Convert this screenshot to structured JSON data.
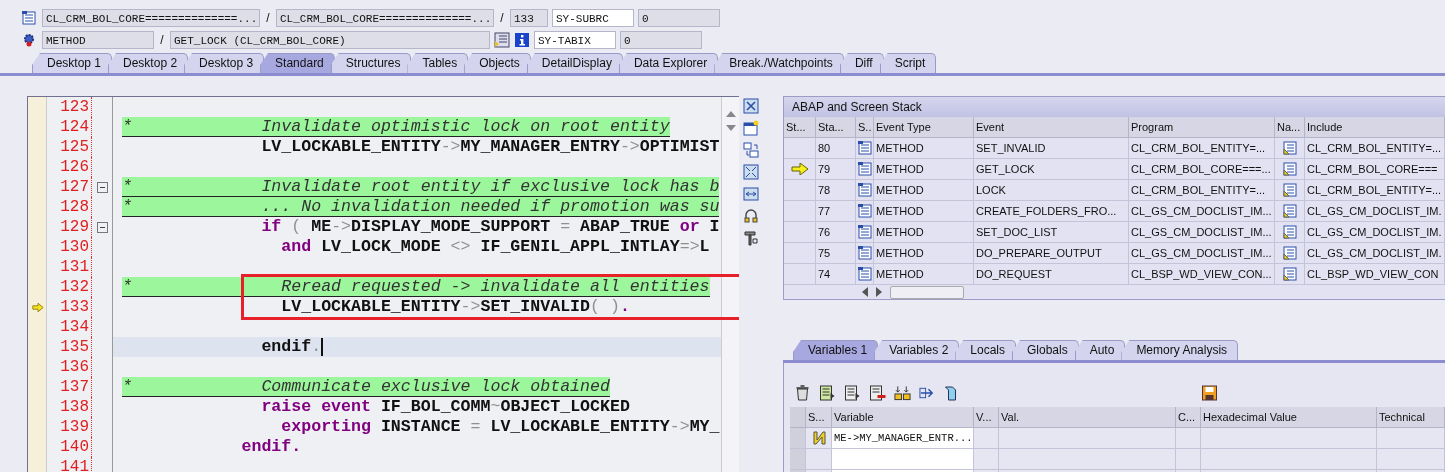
{
  "header": {
    "program": "CL_CRM_BOL_CORE==============...",
    "include": "CL_CRM_BOL_CORE==============...",
    "line": "133",
    "separators": [
      "/",
      "/",
      "/"
    ],
    "event_type": "METHOD",
    "event": "GET_LOCK (CL_CRM_BOL_CORE)",
    "sy_fields": [
      {
        "name": "SY-SUBRC",
        "value": "0"
      },
      {
        "name": "SY-TABIX",
        "value": "0"
      }
    ]
  },
  "tabs": [
    {
      "label": "Desktop 1",
      "selected": false
    },
    {
      "label": "Desktop 2",
      "selected": false
    },
    {
      "label": "Desktop 3",
      "selected": false
    },
    {
      "label": "Standard",
      "selected": true
    },
    {
      "label": "Structures",
      "selected": false
    },
    {
      "label": "Tables",
      "selected": false
    },
    {
      "label": "Objects",
      "selected": false
    },
    {
      "label": "DetailDisplay",
      "selected": false
    },
    {
      "label": "Data Explorer",
      "selected": false
    },
    {
      "label": "Break./Watchpoints",
      "selected": false
    },
    {
      "label": "Diff",
      "selected": false
    },
    {
      "label": "Script",
      "selected": false
    }
  ],
  "code": {
    "lines": [
      {
        "no": "123",
        "kind": "blank",
        "fold": false,
        "current": false,
        "cursor": false,
        "boxed": false
      },
      {
        "no": "124",
        "kind": "comment",
        "text": "*             Invalidate optimistic lock on root entity",
        "fold": false,
        "current": false,
        "cursor": false,
        "boxed": false
      },
      {
        "no": "125",
        "kind": "code",
        "tokens": [
          {
            "kind": "id",
            "text": "              LV_LOCKABLE_ENTITY"
          },
          {
            "kind": "op",
            "text": "->"
          },
          {
            "kind": "id",
            "text": "MY_MANAGER_ENTRY"
          },
          {
            "kind": "op",
            "text": "->"
          },
          {
            "kind": "id",
            "text": "OPTIMIST"
          }
        ],
        "fold": false,
        "current": false,
        "cursor": false,
        "boxed": false
      },
      {
        "no": "126",
        "kind": "blank",
        "fold": false,
        "current": false,
        "cursor": false,
        "boxed": false
      },
      {
        "no": "127",
        "kind": "comment",
        "text": "*             Invalidate root entity if exclusive lock has b",
        "fold": true,
        "current": false,
        "cursor": false,
        "boxed": false
      },
      {
        "no": "128",
        "kind": "comment",
        "text": "*             ... No invalidation needed if promotion was su",
        "fold": false,
        "current": false,
        "cursor": false,
        "boxed": false
      },
      {
        "no": "129",
        "kind": "code",
        "tokens": [
          {
            "kind": "kw",
            "text": "              if"
          },
          {
            "kind": "op",
            "text": " ( "
          },
          {
            "kind": "id",
            "text": "ME"
          },
          {
            "kind": "op",
            "text": "->"
          },
          {
            "kind": "id",
            "text": "DISPLAY_MODE_SUPPORT"
          },
          {
            "kind": "op",
            "text": " = "
          },
          {
            "kind": "id",
            "text": "ABAP_TRUE"
          },
          {
            "kind": "kw",
            "text": " or "
          },
          {
            "kind": "id",
            "text": "I"
          }
        ],
        "fold": true,
        "current": false,
        "cursor": false,
        "boxed": false
      },
      {
        "no": "130",
        "kind": "code",
        "tokens": [
          {
            "kind": "kw",
            "text": "                and"
          },
          {
            "kind": "id",
            "text": " LV_LOCK_MODE"
          },
          {
            "kind": "op",
            "text": " <> "
          },
          {
            "kind": "id",
            "text": "IF_GENIL_APPL_INTLAY"
          },
          {
            "kind": "op",
            "text": "=>"
          },
          {
            "kind": "id",
            "text": "L"
          }
        ],
        "fold": false,
        "current": false,
        "cursor": false,
        "boxed": false
      },
      {
        "no": "131",
        "kind": "blank",
        "fold": false,
        "current": false,
        "cursor": false,
        "boxed": false
      },
      {
        "no": "132",
        "kind": "comment",
        "text": "*               Reread requested -> invalidate all entities",
        "fold": false,
        "current": false,
        "cursor": false,
        "boxed": true
      },
      {
        "no": "133",
        "kind": "code",
        "tokens": [
          {
            "kind": "id",
            "text": "                LV_LOCKABLE_ENTITY"
          },
          {
            "kind": "op",
            "text": "->"
          },
          {
            "kind": "id",
            "text": "SET_INVALID"
          },
          {
            "kind": "op",
            "text": "( )"
          },
          {
            "kind": "kw",
            "text": "."
          }
        ],
        "fold": false,
        "current": true,
        "cursor": false,
        "boxed": true
      },
      {
        "no": "134",
        "kind": "blank",
        "fold": false,
        "current": false,
        "cursor": false,
        "boxed": false
      },
      {
        "no": "135",
        "kind": "code",
        "tokens": [
          {
            "kind": "id",
            "text": "              endif"
          },
          {
            "kind": "op",
            "text": "."
          }
        ],
        "fold": false,
        "current": false,
        "cursor": true,
        "boxed": false
      },
      {
        "no": "136",
        "kind": "blank",
        "fold": false,
        "current": false,
        "cursor": false,
        "boxed": false
      },
      {
        "no": "137",
        "kind": "comment",
        "text": "*             Communicate exclusive lock obtained",
        "fold": false,
        "current": false,
        "cursor": false,
        "boxed": false
      },
      {
        "no": "138",
        "kind": "code",
        "tokens": [
          {
            "kind": "kw",
            "text": "              raise event"
          },
          {
            "kind": "id",
            "text": " IF_BOL_COMM"
          },
          {
            "kind": "op",
            "text": "~"
          },
          {
            "kind": "id",
            "text": "OBJECT_LOCKED"
          }
        ],
        "fold": false,
        "current": false,
        "cursor": false,
        "boxed": false
      },
      {
        "no": "139",
        "kind": "code",
        "tokens": [
          {
            "kind": "kw",
            "text": "                exporting"
          },
          {
            "kind": "id",
            "text": " INSTANCE"
          },
          {
            "kind": "op",
            "text": " = "
          },
          {
            "kind": "id",
            "text": "LV_LOCKABLE_ENTITY"
          },
          {
            "kind": "op",
            "text": "->"
          },
          {
            "kind": "id",
            "text": "MY_"
          }
        ],
        "fold": false,
        "current": false,
        "cursor": false,
        "boxed": false
      },
      {
        "no": "140",
        "kind": "code",
        "tokens": [
          {
            "kind": "kw",
            "text": "            endif."
          }
        ],
        "fold": false,
        "current": false,
        "cursor": false,
        "boxed": false
      },
      {
        "no": "141",
        "kind": "blank",
        "fold": false,
        "current": false,
        "cursor": false,
        "boxed": false
      }
    ]
  },
  "stack": {
    "title": "ABAP and Screen Stack",
    "columns": [
      "St...",
      "Sta...",
      "S..",
      "Event Type",
      "Event",
      "Program",
      "Na...",
      "Include"
    ],
    "rows": [
      {
        "current": false,
        "no": "80",
        "event_type": "METHOD",
        "event": "SET_INVALID",
        "program": "CL_CRM_BOL_ENTITY=...",
        "include": "CL_CRM_BOL_ENTITY=..."
      },
      {
        "current": true,
        "no": "79",
        "event_type": "METHOD",
        "event": "GET_LOCK",
        "program": "CL_CRM_BOL_CORE===...",
        "include": "CL_CRM_BOL_CORE==="
      },
      {
        "current": false,
        "no": "78",
        "event_type": "METHOD",
        "event": "LOCK",
        "program": "CL_CRM_BOL_ENTITY=...",
        "include": "CL_CRM_BOL_ENTITY=..."
      },
      {
        "current": false,
        "no": "77",
        "event_type": "METHOD",
        "event": "CREATE_FOLDERS_FRO...",
        "program": "CL_GS_CM_DOCLIST_IM...",
        "include": "CL_GS_CM_DOCLIST_IM."
      },
      {
        "current": false,
        "no": "76",
        "event_type": "METHOD",
        "event": "SET_DOC_LIST",
        "program": "CL_GS_CM_DOCLIST_IM...",
        "include": "CL_GS_CM_DOCLIST_IM."
      },
      {
        "current": false,
        "no": "75",
        "event_type": "METHOD",
        "event": "DO_PREPARE_OUTPUT",
        "program": "CL_GS_CM_DOCLIST_IM...",
        "include": "CL_GS_CM_DOCLIST_IM."
      },
      {
        "current": false,
        "no": "74",
        "event_type": "METHOD",
        "event": "DO_REQUEST",
        "program": "CL_BSP_WD_VIEW_CON...",
        "include": "CL_BSP_WD_VIEW_CON"
      }
    ]
  },
  "variables": {
    "tabs": [
      {
        "label": "Variables 1",
        "selected": true
      },
      {
        "label": "Variables 2",
        "selected": false
      },
      {
        "label": "Locals",
        "selected": false
      },
      {
        "label": "Globals",
        "selected": false
      },
      {
        "label": "Auto",
        "selected": false
      },
      {
        "label": "Memory Analysis",
        "selected": false
      }
    ],
    "columns": [
      "S...",
      "Variable",
      "V...",
      "Val.",
      "C...",
      "Hexadecimal Value",
      "Technical"
    ],
    "rows": [
      {
        "variable": "ME->MY_MANAGER_ENTR..."
      }
    ]
  }
}
